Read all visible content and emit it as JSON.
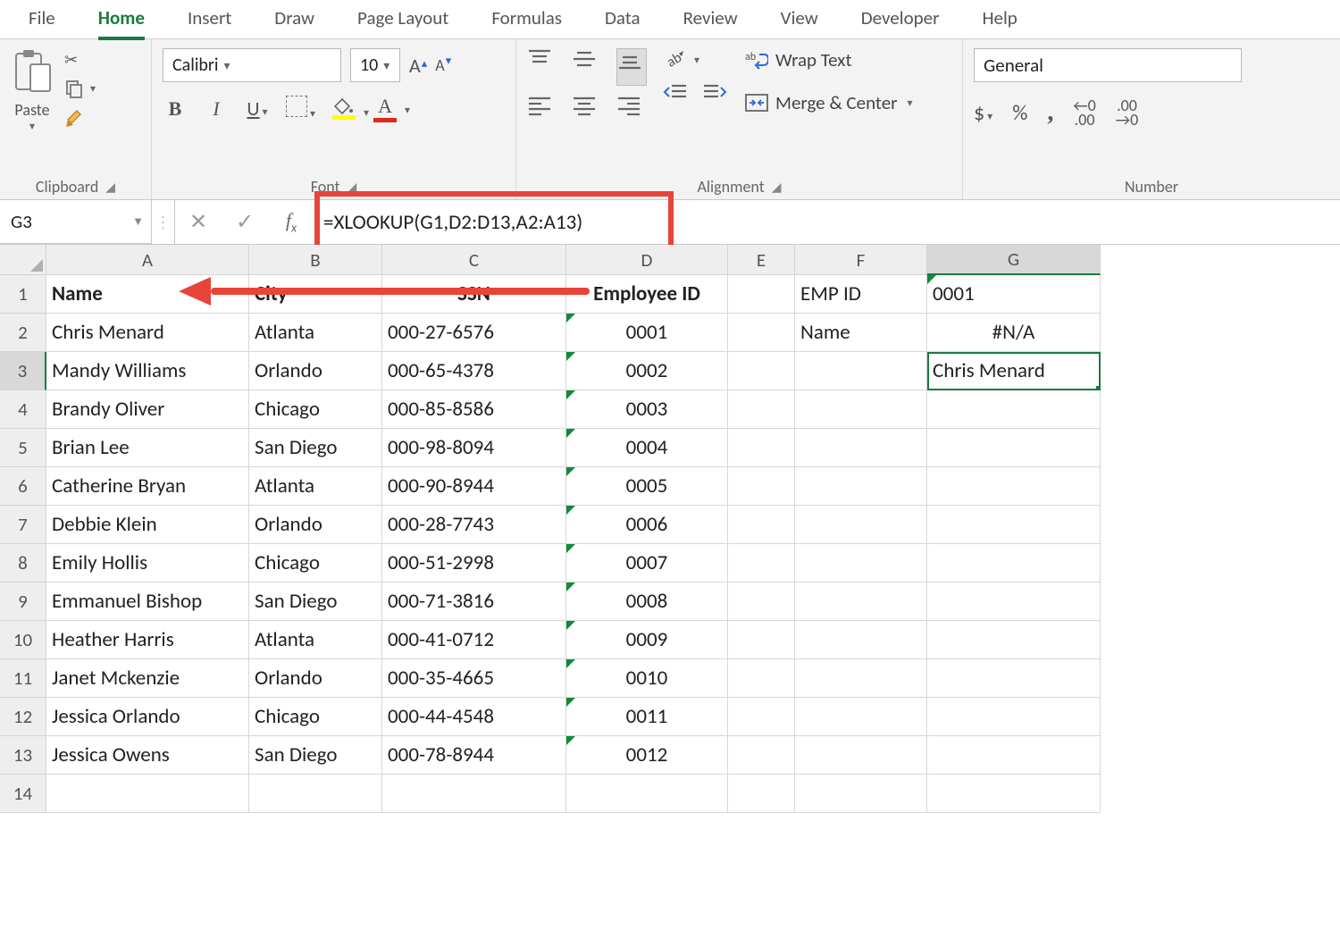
{
  "tabs": [
    "File",
    "Home",
    "Insert",
    "Draw",
    "Page Layout",
    "Formulas",
    "Data",
    "Review",
    "View",
    "Developer",
    "Help"
  ],
  "active_tab": "Home",
  "clipboard": {
    "paste": "Paste",
    "label": "Clipboard"
  },
  "font": {
    "name": "Calibri",
    "size": "10",
    "label": "Font",
    "bold": "B",
    "italic": "I",
    "underline": "U"
  },
  "alignment": {
    "label": "Alignment",
    "wrap": "Wrap Text",
    "merge": "Merge & Center"
  },
  "number": {
    "label": "Number",
    "format": "General",
    "dollar": "$",
    "percent": "%",
    "comma": ",",
    "inc": "←0\n.00",
    "dec": ".00\n→0"
  },
  "namebox": "G3",
  "formula": "=XLOOKUP(G1,D2:D13,A2:A13)",
  "cols": [
    "A",
    "B",
    "C",
    "D",
    "E",
    "F",
    "G"
  ],
  "rows": [
    "1",
    "2",
    "3",
    "4",
    "5",
    "6",
    "7",
    "8",
    "9",
    "10",
    "11",
    "12",
    "13",
    "14"
  ],
  "header_row": {
    "a": "Name",
    "b": "City",
    "c": "SSN",
    "d": "Employee ID"
  },
  "side": {
    "f1": "EMP ID",
    "f2": "Name",
    "g1": "0001",
    "g2": "#N/A",
    "g3": "Chris Menard"
  },
  "data": [
    {
      "name": "Chris Menard",
      "city": "Atlanta",
      "ssn": "000-27-6576",
      "id": "0001"
    },
    {
      "name": "Mandy Williams",
      "city": "Orlando",
      "ssn": "000-65-4378",
      "id": "0002"
    },
    {
      "name": "Brandy Oliver",
      "city": "Chicago",
      "ssn": "000-85-8586",
      "id": "0003"
    },
    {
      "name": "Brian Lee",
      "city": "San Diego",
      "ssn": "000-98-8094",
      "id": "0004"
    },
    {
      "name": "Catherine Bryan",
      "city": "Atlanta",
      "ssn": "000-90-8944",
      "id": "0005"
    },
    {
      "name": "Debbie Klein",
      "city": "Orlando",
      "ssn": "000-28-7743",
      "id": "0006"
    },
    {
      "name": "Emily Hollis",
      "city": "Chicago",
      "ssn": "000-51-2998",
      "id": "0007"
    },
    {
      "name": "Emmanuel Bishop",
      "city": "San Diego",
      "ssn": "000-71-3816",
      "id": "0008"
    },
    {
      "name": "Heather Harris",
      "city": "Atlanta",
      "ssn": "000-41-0712",
      "id": "0009"
    },
    {
      "name": "Janet Mckenzie",
      "city": "Orlando",
      "ssn": "000-35-4665",
      "id": "0010"
    },
    {
      "name": "Jessica Orlando",
      "city": "Chicago",
      "ssn": "000-44-4548",
      "id": "0011"
    },
    {
      "name": "Jessica Owens",
      "city": "San Diego",
      "ssn": "000-78-8944",
      "id": "0012"
    }
  ]
}
